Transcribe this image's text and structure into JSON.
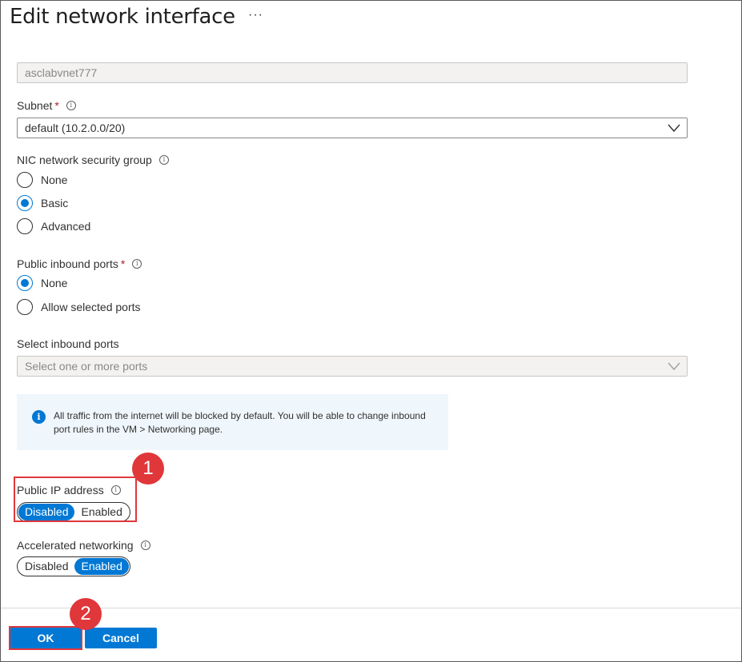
{
  "header": {
    "title": "Edit network interface",
    "more_label": "···"
  },
  "vnet": {
    "value": "asclabvnet777"
  },
  "subnet": {
    "label": "Subnet",
    "required": "*",
    "value": "default (10.2.0.0/20)"
  },
  "nsg": {
    "label": "NIC network security group",
    "options": [
      "None",
      "Basic",
      "Advanced"
    ],
    "selected": "Basic"
  },
  "inbound": {
    "label": "Public inbound ports",
    "required": "*",
    "options": [
      "None",
      "Allow selected ports"
    ],
    "selected": "None"
  },
  "select_ports": {
    "label": "Select inbound ports",
    "placeholder": "Select one or more ports"
  },
  "info_message": "All traffic from the internet will be blocked by default. You will be able to change inbound port rules in the VM > Networking page.",
  "public_ip": {
    "label": "Public IP address",
    "options": [
      "Disabled",
      "Enabled"
    ],
    "selected": "Disabled"
  },
  "accel": {
    "label": "Accelerated networking",
    "options": [
      "Disabled",
      "Enabled"
    ],
    "selected": "Enabled"
  },
  "callouts": [
    "1",
    "2"
  ],
  "footer": {
    "ok_label": "OK",
    "cancel_label": "Cancel"
  },
  "colors": {
    "accent": "#0078d4",
    "highlight": "#e0373a",
    "info_bg": "#eff6fc"
  }
}
